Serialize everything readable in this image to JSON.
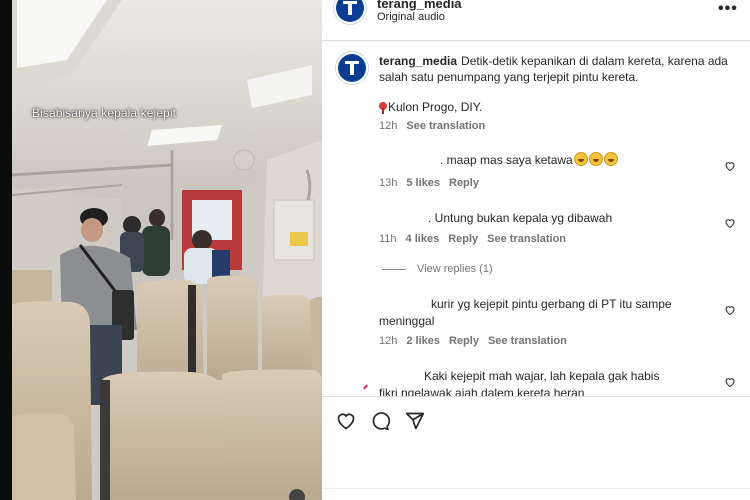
{
  "video": {
    "caption": "Bisabisanya kepala kejepit"
  },
  "header": {
    "username": "terang_media",
    "audio": "Original audio",
    "more_icon": "more-horizontal-icon"
  },
  "post": {
    "username": "terang_media",
    "text": "Detik-detik kepanikan di dalam kereta, karena ada salah satu penumpang yang terjepit pintu kereta.",
    "location": "Kulon Progo, DIY.",
    "time": "12h",
    "see_translation": "See translation"
  },
  "comments": [
    {
      "text": ". maap mas saya ketawa",
      "time": "13h",
      "likes": "5 likes",
      "reply": "Reply",
      "translation": ""
    },
    {
      "text": ". Untung bukan kepala yg dibawah",
      "time": "11h",
      "likes": "4 likes",
      "reply": "Reply",
      "translation": "See translation"
    },
    {
      "text": "kurir yg kejepit pintu gerbang di PT itu sampe meninggal",
      "time": "12h",
      "likes": "2 likes",
      "reply": "Reply",
      "translation": "See translation"
    },
    {
      "text": "Kaki kejepit mah wajar, lah kepala gak habis fikri ngelawak ajah dalem kereta heran",
      "time": "",
      "likes": "",
      "reply": "",
      "translation": ""
    }
  ],
  "view_replies": "View replies (1)",
  "actions": [
    "heart-icon",
    "comment-icon",
    "share-icon"
  ],
  "colors": {
    "brand": "#0a3d91",
    "text": "#262626",
    "meta": "#737373"
  }
}
